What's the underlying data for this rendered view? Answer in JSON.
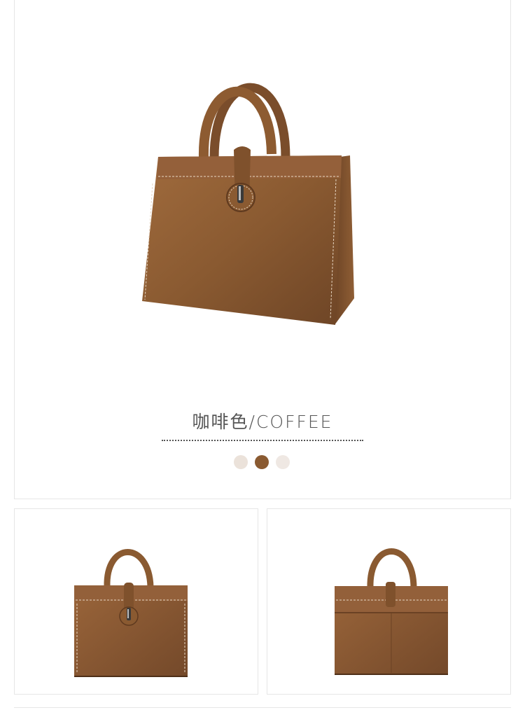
{
  "product": {
    "color_label": "咖啡色/COFFEE",
    "swatches": [
      {
        "name": "light-beige",
        "color": "#ebe2da",
        "selected": false
      },
      {
        "name": "coffee",
        "color": "#8a5a31",
        "selected": true
      },
      {
        "name": "off-white",
        "color": "#efe8e3",
        "selected": false
      }
    ]
  },
  "colors": {
    "leather": "#8a5a31",
    "leather_dark": "#6b4224",
    "border": "#e6e6e6"
  }
}
